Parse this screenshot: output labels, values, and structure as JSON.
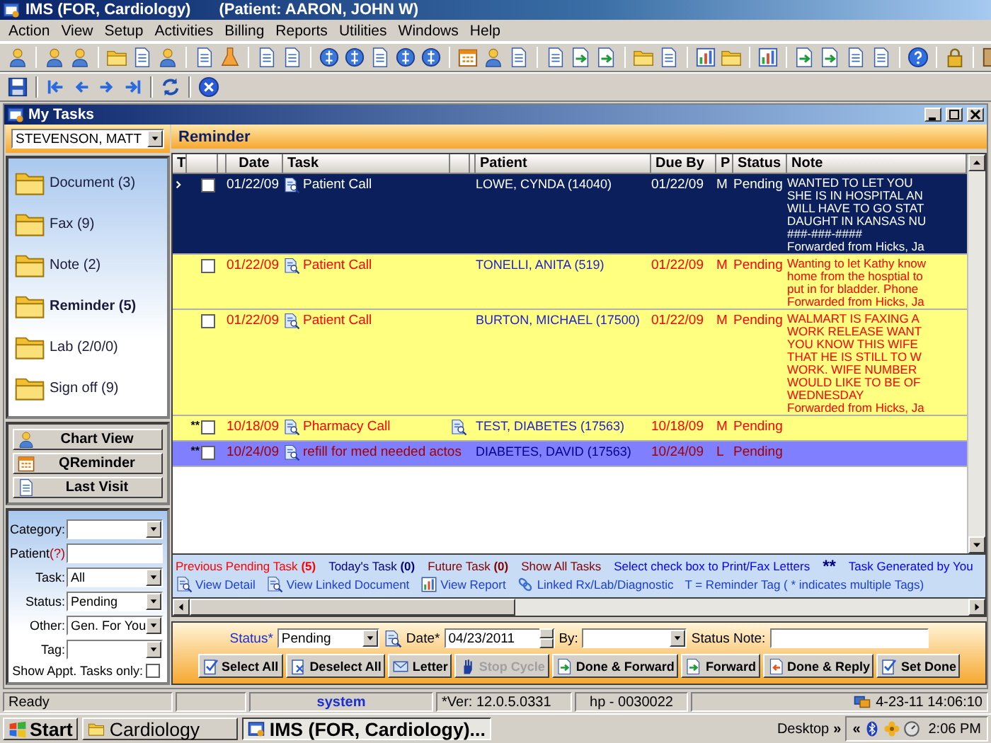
{
  "window": {
    "title": "IMS (FOR, Cardiology)",
    "patient": "(Patient: AARON, JOHN W)"
  },
  "menu": [
    "Action",
    "View",
    "Setup",
    "Activities",
    "Billing",
    "Reports",
    "Utilities",
    "Windows",
    "Help"
  ],
  "inner_window": {
    "title": "My Tasks"
  },
  "user_select": {
    "value": "STEVENSON, MATT"
  },
  "folders": [
    {
      "label": "Document (3)",
      "selected": false
    },
    {
      "label": "Fax (9)",
      "selected": false
    },
    {
      "label": "Note (2)",
      "selected": false
    },
    {
      "label": "Reminder (5)",
      "selected": true
    },
    {
      "label": "Lab (2/0/0)",
      "selected": false
    },
    {
      "label": "Sign off (9)",
      "selected": false
    }
  ],
  "nav_buttons": [
    "Chart View",
    "QReminder",
    "Last Visit"
  ],
  "filters": [
    {
      "kind": "select",
      "label": "Category:"
    },
    {
      "kind": "text",
      "label": "Patient",
      "help": "(?)"
    },
    {
      "kind": "select",
      "label": "Task:",
      "value": "All"
    },
    {
      "kind": "select",
      "label": "Status:",
      "value": "Pending"
    },
    {
      "kind": "select",
      "label": "Other:",
      "value": "Gen. For You"
    },
    {
      "kind": "select",
      "label": "Tag:"
    },
    {
      "kind": "checkbox",
      "label": "Show Appt. Tasks only:",
      "checked": false
    }
  ],
  "section_title": "Reminder",
  "table": {
    "columns": {
      "t": "T",
      "date": "Date",
      "task": "Task",
      "patient": "Patient",
      "due_by": "Due By",
      "p": "P",
      "status": "Status",
      "note": "Note"
    },
    "rows": [
      {
        "selected": true,
        "checked": false,
        "date": "01/22/09",
        "task": "Patient Call",
        "patient": "LOWE, CYNDA  (14040)",
        "due_by": "01/22/09",
        "p": "M",
        "status": "Pending",
        "note": [
          "WANTED TO LET YOU",
          "SHE IS IN HOSPITAL AN",
          "WILL HAVE TO GO STAT",
          "DAUGHT IN KANSAS NU",
          "###-###-####",
          "Forwarded from Hicks, Ja"
        ]
      },
      {
        "selected": false,
        "checked": false,
        "color": "#ffff80",
        "date": "01/22/09",
        "task": "Patient Call",
        "patient": "TONELLI, ANITA  (519)",
        "due_by": "01/22/09",
        "p": "M",
        "status": "Pending",
        "note": [
          "Wanting to let Kathy know",
          "home from the hosptial to",
          "put in for bladder.  Phone",
          "Forwarded from Hicks, Ja"
        ]
      },
      {
        "selected": false,
        "checked": false,
        "color": "#ffff80",
        "date": "01/22/09",
        "task": "Patient Call",
        "patient": "BURTON, MICHAEL  (17500)",
        "due_by": "01/22/09",
        "p": "M",
        "status": "Pending",
        "note": [
          "WALMART IS FAXING A",
          "WORK RELEASE WANT",
          "YOU KNOW THIS WIFE",
          "THAT HE IS STILL TO W",
          "WORK. WIFE NUMBER",
          "WOULD LIKE TO BE OF",
          "WEDNESDAY",
          "Forwarded from Hicks, Ja"
        ]
      },
      {
        "selected": false,
        "checked": false,
        "color": "#ffff80",
        "marker": "**",
        "linked_document": true,
        "date": "10/18/09",
        "task": "Pharmacy Call",
        "patient": "TEST, DIABETES  (17563)",
        "due_by": "10/18/09",
        "p": "M",
        "status": "Pending"
      },
      {
        "selected": false,
        "checked": false,
        "color": "#8080ff",
        "marker": "**",
        "date": "10/24/09",
        "task": "refill for med needed actos",
        "patient": "DIABETES, DAVID  (17563)",
        "due_by": "10/24/09",
        "p": "L",
        "status": "Pending"
      }
    ]
  },
  "legend_row1": [
    {
      "text": "Previous Pending Task **(5)**",
      "color": "#ff0000"
    },
    {
      "text": "Today's Task **(0)**",
      "color": "#000080"
    },
    {
      "text": "Future Task **(0)**",
      "color": "#800000"
    },
    {
      "text": "Show All Tasks",
      "color": "#800000"
    },
    {
      "text": "Select check box to Print/Fax Letters",
      "color": "#0000ff"
    },
    {
      "text": "**",
      "color": "#000080"
    },
    {
      "text": "Task Generated by You",
      "color": "#0000ff"
    }
  ],
  "legend_row2": [
    {
      "kind": "detail",
      "text": "View Detail"
    },
    {
      "kind": "linked",
      "text": "View Linked Document"
    },
    {
      "kind": "report",
      "text": "View Report"
    },
    {
      "kind": "rx",
      "text": "Linked Rx/Lab/Diagnostic"
    },
    {
      "kind": "note",
      "text": "T = Reminder Tag ( * indicates multiple Tags)"
    }
  ],
  "action_panel": {
    "status": {
      "label": "Status*",
      "value": "Pending"
    },
    "date": {
      "label": "Date*",
      "value": "04/23/2011"
    },
    "by": {
      "label": "By:"
    },
    "status_note": {
      "label": "Status Note:"
    }
  },
  "action_buttons": [
    {
      "kind": "select",
      "label": "Select All",
      "disabled": false
    },
    {
      "kind": "deselect",
      "label": "Deselect All",
      "disabled": false
    },
    {
      "kind": "letter",
      "label": "Letter",
      "disabled": false
    },
    {
      "kind": "stop",
      "label": "Stop Cycle",
      "disabled": true
    },
    {
      "kind": "done_forward",
      "label": "Done & Forward",
      "disabled": false
    },
    {
      "kind": "forward",
      "label": "Forward",
      "disabled": false
    },
    {
      "kind": "done_reply",
      "label": "Done & Reply",
      "disabled": false
    },
    {
      "kind": "done",
      "label": "Set Done",
      "disabled": false
    }
  ],
  "status_bar": {
    "message": "Ready",
    "user": "system",
    "version": "*Ver: 12.0.5.0331",
    "machine": "hp - 0030022",
    "datetime": "4-23-11 14:06:10"
  },
  "taskbar": {
    "start": "Start",
    "tasks": [
      {
        "kind": "folder",
        "label": "Cardiology",
        "selected": false
      },
      {
        "kind": "app",
        "label": "IMS (FOR, Cardiology)...",
        "selected": true
      }
    ],
    "desktop": "Desktop",
    "expand": "»",
    "collapse": "«",
    "clock": "2:06 PM"
  }
}
